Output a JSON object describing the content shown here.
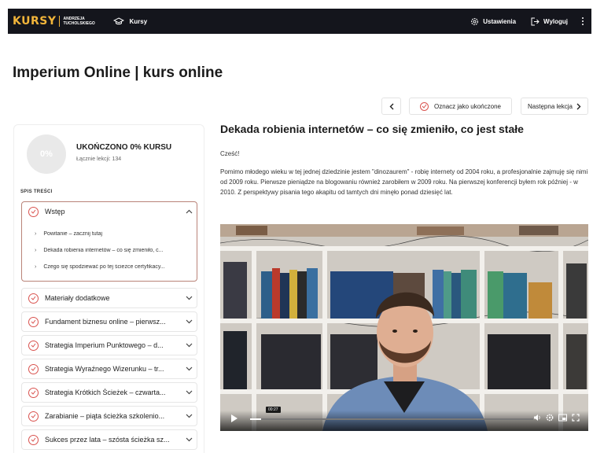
{
  "header": {
    "logo_word": "KURSY",
    "logo_sub_line1": "ANDRZEJA",
    "logo_sub_line2": "TUCHOLSKIEGO",
    "nav_kursy": "Kursy",
    "settings": "Ustawienia",
    "logout": "Wyloguj"
  },
  "page_title": "Imperium Online | kurs online",
  "lesson_nav": {
    "mark_complete": "Oznacz jako ukończone",
    "next": "Następna lekcja"
  },
  "sidebar": {
    "progress_percent": "0%",
    "progress_title": "UKOŃCZONO 0% KURSU",
    "progress_sub": "Łącznie lekcji: 134",
    "toc_label": "SPIS TREŚCI",
    "sections": [
      {
        "label": "Wstęp",
        "open": true,
        "lessons": [
          "Powitanie – zacznij tutaj",
          "Dekada robienia internetów – co się zmieniło, c...",
          "Czego się spodziewać po tej ścieżce certyfikacy..."
        ]
      },
      {
        "label": "Materiały dodatkowe"
      },
      {
        "label": "Fundament biznesu online – pierwsz..."
      },
      {
        "label": "Strategia Imperium Punktowego – d..."
      },
      {
        "label": "Strategia Wyraźnego Wizerunku – tr..."
      },
      {
        "label": "Strategia Krótkich Ścieżek – czwarta..."
      },
      {
        "label": "Zarabianie – piąta ścieżka szkolenio..."
      },
      {
        "label": "Sukces przez lata – szósta ścieżka sz..."
      }
    ]
  },
  "lesson": {
    "title": "Dekada robienia internetów – co się zmieniło, co jest stałe",
    "greeting": "Cześć!",
    "paragraph": "Pomimo młodego wieku w tej jednej dziedzinie jestem \"dinozaurem\" - robię internety od 2004 roku, a profesjonalnie zajmuję się nimi od 2009 roku. Pierwsze pieniądze na blogowaniu również zarobiłem w 2009 roku. Na pierwszej konferencji byłem rok później - w 2010. Z perspektywy pisania tego akapitu od tamtych dni minęło ponad dziesięć lat."
  },
  "video": {
    "time": "00:27",
    "progress": 0.04
  },
  "colors": {
    "accent_red": "#d9534f",
    "logo_gold": "#f2b53a",
    "header_bg": "#14151c"
  }
}
